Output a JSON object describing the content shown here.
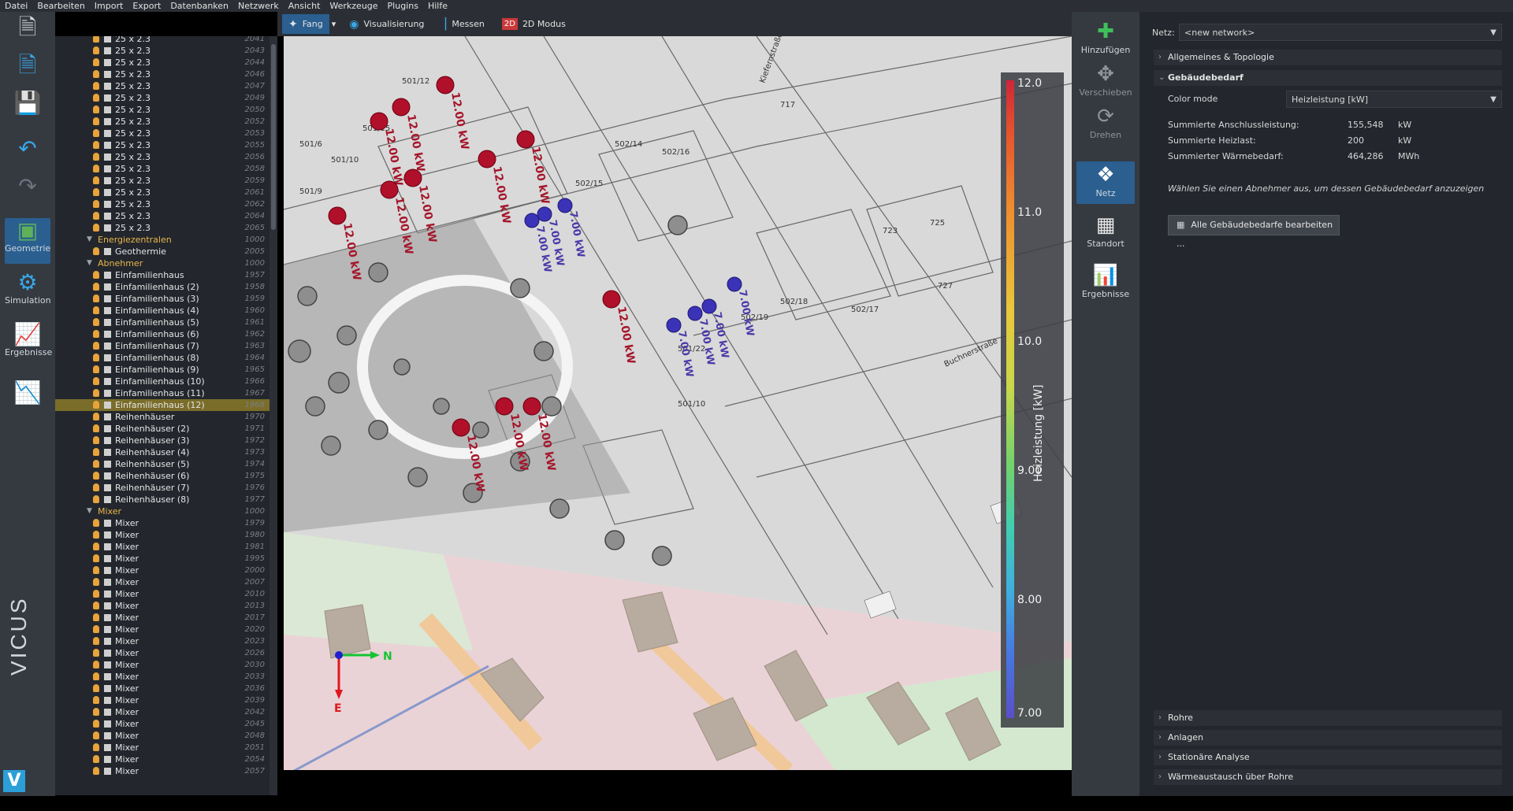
{
  "menu": [
    "Datei",
    "Bearbeiten",
    "Import",
    "Export",
    "Datenbanken",
    "Netzwerk",
    "Ansicht",
    "Werkzeuge",
    "Plugins",
    "Hilfe"
  ],
  "left_sidebar": [
    {
      "label": "Geometrie",
      "icon": "cube-icon",
      "selected": true
    },
    {
      "label": "Simulation",
      "icon": "gear-icon",
      "selected": false
    },
    {
      "label": "Ergebnisse",
      "icon": "chart-icon",
      "selected": false
    }
  ],
  "brand": "VICUS",
  "brand_logo": "V",
  "tree": {
    "top_items": [
      {
        "label": "25 x 2.3",
        "num": "2041"
      },
      {
        "label": "25 x 2.3",
        "num": "2043"
      },
      {
        "label": "25 x 2.3",
        "num": "2044"
      },
      {
        "label": "25 x 2.3",
        "num": "2046"
      },
      {
        "label": "25 x 2.3",
        "num": "2047"
      },
      {
        "label": "25 x 2.3",
        "num": "2049"
      },
      {
        "label": "25 x 2.3",
        "num": "2050"
      },
      {
        "label": "25 x 2.3",
        "num": "2052"
      },
      {
        "label": "25 x 2.3",
        "num": "2053"
      },
      {
        "label": "25 x 2.3",
        "num": "2055"
      },
      {
        "label": "25 x 2.3",
        "num": "2056"
      },
      {
        "label": "25 x 2.3",
        "num": "2058"
      },
      {
        "label": "25 x 2.3",
        "num": "2059"
      },
      {
        "label": "25 x 2.3",
        "num": "2061"
      },
      {
        "label": "25 x 2.3",
        "num": "2062"
      },
      {
        "label": "25 x 2.3",
        "num": "2064"
      },
      {
        "label": "25 x 2.3",
        "num": "2065"
      }
    ],
    "groups": [
      {
        "label": "Energiezentralen",
        "num": "1000",
        "items": [
          {
            "label": "Geothermie",
            "num": "2005"
          }
        ]
      },
      {
        "label": "Abnehmer",
        "num": "1000",
        "items": [
          {
            "label": "Einfamilienhaus",
            "num": "1957"
          },
          {
            "label": "Einfamilienhaus (2)",
            "num": "1958"
          },
          {
            "label": "Einfamilienhaus (3)",
            "num": "1959"
          },
          {
            "label": "Einfamilienhaus (4)",
            "num": "1960"
          },
          {
            "label": "Einfamilienhaus (5)",
            "num": "1961"
          },
          {
            "label": "Einfamilienhaus (6)",
            "num": "1962"
          },
          {
            "label": "Einfamilienhaus (7)",
            "num": "1963"
          },
          {
            "label": "Einfamilienhaus (8)",
            "num": "1964"
          },
          {
            "label": "Einfamilienhaus (9)",
            "num": "1965"
          },
          {
            "label": "Einfamilienhaus (10)",
            "num": "1966"
          },
          {
            "label": "Einfamilienhaus (11)",
            "num": "1967"
          },
          {
            "label": "Einfamilienhaus (12)",
            "num": "1968",
            "highlight": true
          },
          {
            "label": "Reihenhäuser",
            "num": "1970"
          },
          {
            "label": "Reihenhäuser (2)",
            "num": "1971"
          },
          {
            "label": "Reihenhäuser (3)",
            "num": "1972"
          },
          {
            "label": "Reihenhäuser (4)",
            "num": "1973"
          },
          {
            "label": "Reihenhäuser (5)",
            "num": "1974"
          },
          {
            "label": "Reihenhäuser (6)",
            "num": "1975"
          },
          {
            "label": "Reihenhäuser (7)",
            "num": "1976"
          },
          {
            "label": "Reihenhäuser (8)",
            "num": "1977"
          }
        ]
      },
      {
        "label": "Mixer",
        "num": "1000",
        "items": [
          {
            "label": "Mixer",
            "num": "1979"
          },
          {
            "label": "Mixer",
            "num": "1980"
          },
          {
            "label": "Mixer",
            "num": "1981"
          },
          {
            "label": "Mixer",
            "num": "1995"
          },
          {
            "label": "Mixer",
            "num": "2000"
          },
          {
            "label": "Mixer",
            "num": "2007"
          },
          {
            "label": "Mixer",
            "num": "2010"
          },
          {
            "label": "Mixer",
            "num": "2013"
          },
          {
            "label": "Mixer",
            "num": "2017"
          },
          {
            "label": "Mixer",
            "num": "2020"
          },
          {
            "label": "Mixer",
            "num": "2023"
          },
          {
            "label": "Mixer",
            "num": "2026"
          },
          {
            "label": "Mixer",
            "num": "2030"
          },
          {
            "label": "Mixer",
            "num": "2033"
          },
          {
            "label": "Mixer",
            "num": "2036"
          },
          {
            "label": "Mixer",
            "num": "2039"
          },
          {
            "label": "Mixer",
            "num": "2042"
          },
          {
            "label": "Mixer",
            "num": "2045"
          },
          {
            "label": "Mixer",
            "num": "2048"
          },
          {
            "label": "Mixer",
            "num": "2051"
          },
          {
            "label": "Mixer",
            "num": "2054"
          },
          {
            "label": "Mixer",
            "num": "2057"
          }
        ]
      }
    ]
  },
  "toolbar": [
    {
      "label": "Fang",
      "active": true,
      "icon": "snap-icon"
    },
    {
      "label": "Visualisierung",
      "active": false,
      "icon": "eye-icon"
    },
    {
      "label": "Messen",
      "active": false,
      "icon": "ruler-icon"
    },
    {
      "label": "2D Modus",
      "active": false,
      "icon": "2d-icon"
    }
  ],
  "toolbar_2d_badge": "2D",
  "map": {
    "parcel_labels": [
      "501/12",
      "501/15",
      "501/6",
      "501/10",
      "501/9",
      "502/14",
      "502/15",
      "502/16",
      "502/18",
      "502/19",
      "502/17",
      "501/22",
      "501/10",
      "725",
      "727",
      "723",
      "717"
    ],
    "street_labels": [
      "Buchnerstraße",
      "Kiefernstraße"
    ],
    "red_labels": [
      "12.00 kW",
      "12.00 kW",
      "12.00 kW",
      "12.00 kW",
      "12.00 kW",
      "12.00 kW",
      "12.00 kW",
      "12.00 kW",
      "12.00 kW",
      "12.00 kW",
      "12.00 kW",
      "12.00 kW"
    ],
    "blue_labels": [
      "7.00 kW",
      "7.00 kW",
      "7.00 kW",
      "7.00 kW",
      "7.00 kW",
      "7.00 kW",
      "7.00 kW"
    ],
    "axis": {
      "n": "N",
      "e": "E"
    }
  },
  "legend": {
    "title": "Heizleistung [kW]",
    "ticks": [
      "12.0",
      "11.0",
      "10.0",
      "9.00",
      "8.00",
      "7.00"
    ]
  },
  "right_tools": [
    {
      "label": "Hinzufügen",
      "icon": "plus-icon",
      "state": "normal"
    },
    {
      "label": "Verschieben",
      "icon": "move-icon",
      "state": "dim"
    },
    {
      "label": "Drehen",
      "icon": "rotate-icon",
      "state": "dim"
    },
    {
      "label": "Netz",
      "icon": "network-icon",
      "state": "selected"
    },
    {
      "label": "Standort",
      "icon": "grid-icon",
      "state": "normal"
    },
    {
      "label": "Ergebnisse",
      "icon": "results-icon",
      "state": "normal"
    }
  ],
  "properties": {
    "netz_label": "Netz:",
    "netz_value": "<new network>",
    "sections_top": [
      "Allgemeines & Topologie"
    ],
    "gebaeude": {
      "title": "Gebäudebedarf",
      "color_mode_label": "Color mode",
      "color_mode_value": "Heizleistung [kW]",
      "rows": [
        {
          "label": "Summierte Anschlussleistung:",
          "value": "155,548",
          "unit": "kW"
        },
        {
          "label": "Summierte Heizlast:",
          "value": "200",
          "unit": "kW"
        },
        {
          "label": "Summierter Wärmebedarf:",
          "value": "464,286",
          "unit": "MWh"
        }
      ],
      "hint": "Wählen Sie einen Abnehmer aus, um dessen Gebäudebedarf anzuzeigen",
      "button": "Alle Gebäudebedarfe bearbeiten ..."
    },
    "sections_bottom": [
      "Rohre",
      "Anlagen",
      "Stationäre Analyse",
      "Wärmeaustausch über Rohre"
    ]
  }
}
